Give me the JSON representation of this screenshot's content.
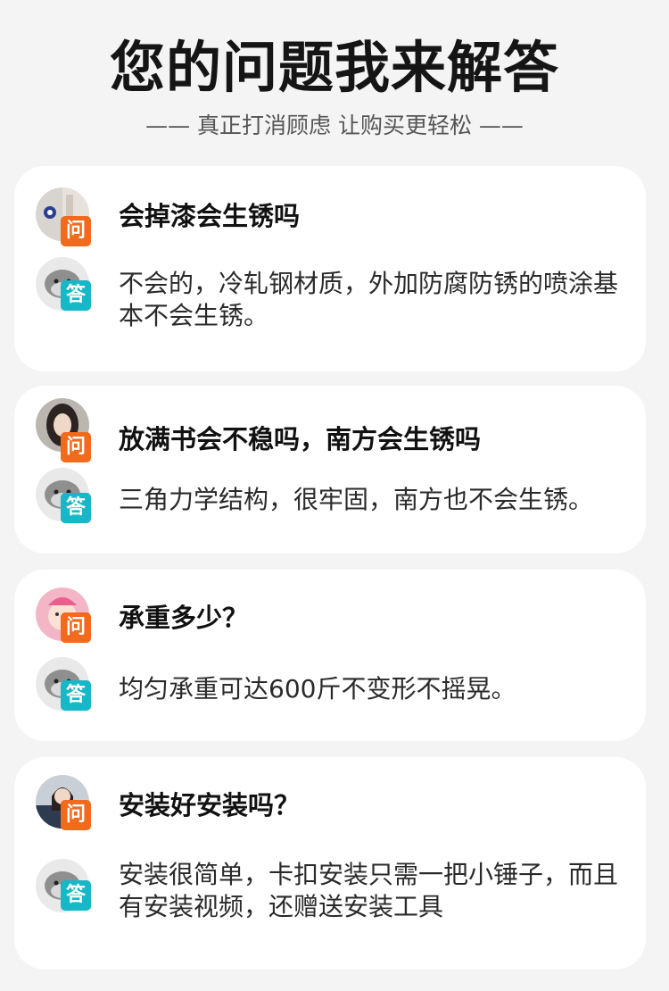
{
  "header": {
    "title": "您的问题我来解答",
    "subtitle": "—— 真正打消顾虑 让购买更轻松 ——"
  },
  "badges": {
    "question": "问",
    "answer": "答"
  },
  "colors": {
    "question_badge": "#f26a1b",
    "answer_badge": "#16b7c6",
    "card": "#ffffff",
    "background": "#f4f4f4"
  },
  "qa": [
    {
      "question": "会掉漆会生锈吗",
      "answer": "不会的，冷轧钢材质，外加防腐防锈的喷涂基本不会生锈。"
    },
    {
      "question": "放满书会不稳吗，南方会生锈吗",
      "answer": "三角力学结构，很牢固，南方也不会生锈。"
    },
    {
      "question": "承重多少？",
      "answer": "均匀承重可达600斤不变形不摇晃。"
    },
    {
      "question": "安装好安装吗？",
      "answer": "安装很简单，卡扣安装只需一把小锤子，而且有安装视频，还赠送安装工具"
    }
  ]
}
